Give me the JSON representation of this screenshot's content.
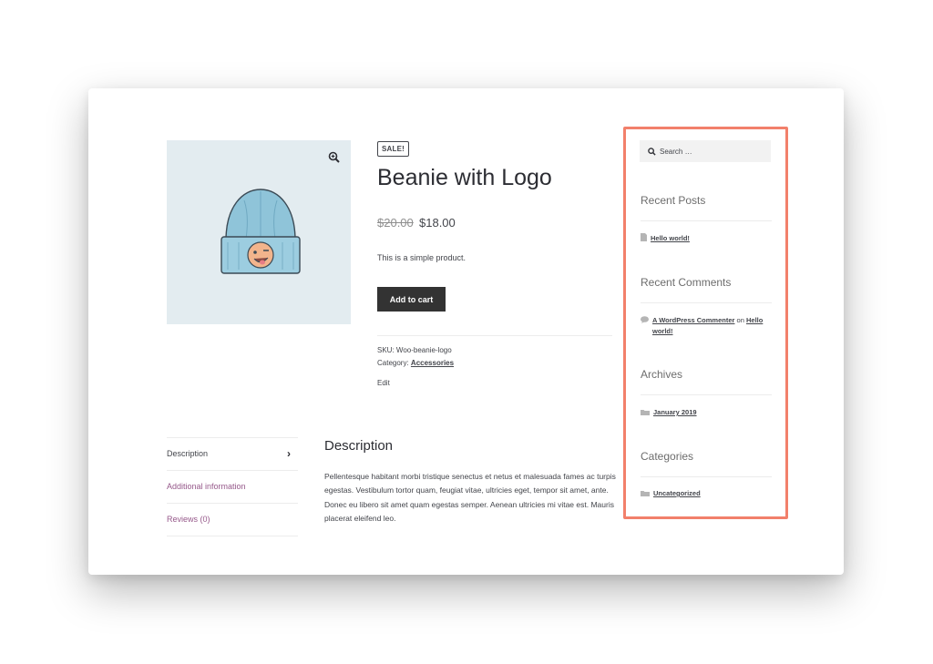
{
  "product": {
    "badge": "SALE!",
    "title": "Beanie with Logo",
    "price_old": "$20.00",
    "price_new": "$18.00",
    "short_description": "This is a simple product.",
    "add_to_cart_label": "Add to cart",
    "sku_label": "SKU:",
    "sku_value": "Woo-beanie-logo",
    "category_label": "Category:",
    "category_value": "Accessories",
    "edit_label": "Edit"
  },
  "tabs": [
    {
      "label": "Description"
    },
    {
      "label": "Additional information"
    },
    {
      "label": "Reviews (0)"
    }
  ],
  "description": {
    "title": "Description",
    "body": "Pellentesque habitant morbi tristique senectus et netus et malesuada fames ac turpis egestas. Vestibulum tortor quam, feugiat vitae, ultricies eget, tempor sit amet, ante. Donec eu libero sit amet quam egestas semper. Aenean ultricies mi vitae est. Mauris placerat eleifend leo."
  },
  "sidebar": {
    "search_placeholder": "Search …",
    "recent_posts": {
      "title": "Recent Posts",
      "item": "Hello world!"
    },
    "recent_comments": {
      "title": "Recent Comments",
      "author": "A WordPress Commenter",
      "on": "on",
      "post_line1": "Hello",
      "post_line2": "world!"
    },
    "archives": {
      "title": "Archives",
      "item": "January 2019"
    },
    "categories": {
      "title": "Categories",
      "item": "Uncategorized"
    }
  },
  "colors": {
    "highlight_border": "#f2806b",
    "button_bg": "#333333",
    "tab_link": "#96588a",
    "gallery_bg": "#e3ecf0"
  },
  "icons": [
    "zoom-icon",
    "search-icon",
    "post-icon",
    "comment-icon",
    "folder-icon",
    "chevron-right-icon"
  ]
}
